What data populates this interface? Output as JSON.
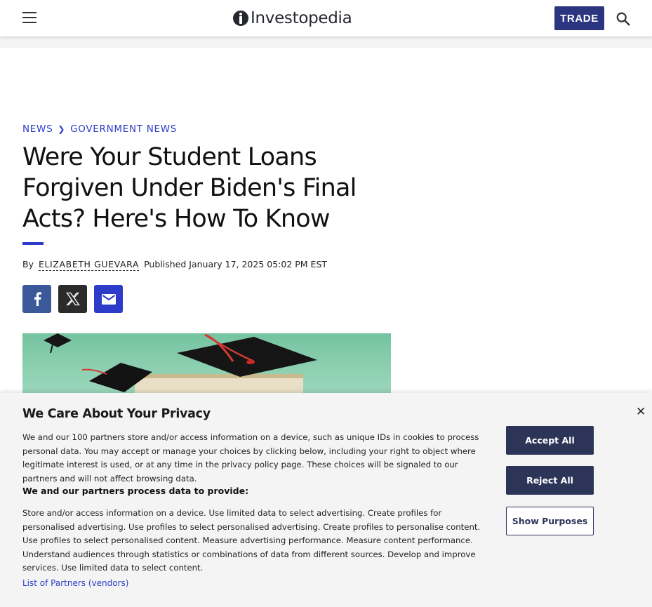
{
  "header": {
    "logo_text": "Investopedia",
    "trade_label": "TRADE",
    "icons": {
      "menu": "hamburger-menu-icon",
      "search": "search-icon",
      "logo": "investopedia-logo-icon"
    }
  },
  "breadcrumb": {
    "items": [
      "NEWS",
      "GOVERNMENT NEWS"
    ],
    "separator": "❯"
  },
  "article": {
    "title": "Were Your Student Loans Forgiven Under Biden's Final Acts? Here's How To Know",
    "by_label": "By",
    "author": "ELIZABETH GUEVARA",
    "published": "Published January 17, 2025 05:02 PM EST"
  },
  "share": {
    "icons": [
      "facebook-icon",
      "x-twitter-icon",
      "email-icon"
    ]
  },
  "privacy": {
    "title": "We Care About Your Privacy",
    "body": "We and our 100 partners store and/or access information on a device, such as unique IDs in cookies to process personal data. You may accept or manage your choices by clicking below, including your right to object where legitimate interest is used, or at any time in the privacy policy page. These choices will be signaled to our partners and will not affect browsing data.",
    "subheading": "We and our partners process data to provide:",
    "purposes": "Store and/or access information on a device. Use limited data to select advertising. Create profiles for personalised advertising. Use profiles to select personalised advertising. Create profiles to personalise content. Use profiles to select personalised content. Measure advertising performance. Measure content performance. Understand audiences through statistics or combinations of data from different sources. Develop and improve services. Use limited data to select content.",
    "partners_link": "List of Partners (vendors)",
    "close": "✕",
    "accept_label": "Accept All",
    "reject_label": "Reject All",
    "purposes_label": "Show Purposes"
  },
  "colors": {
    "brand": "#2c3580",
    "accent": "#2c3cc8",
    "facebook": "#3b5998",
    "dark_button": "#2c3558"
  }
}
